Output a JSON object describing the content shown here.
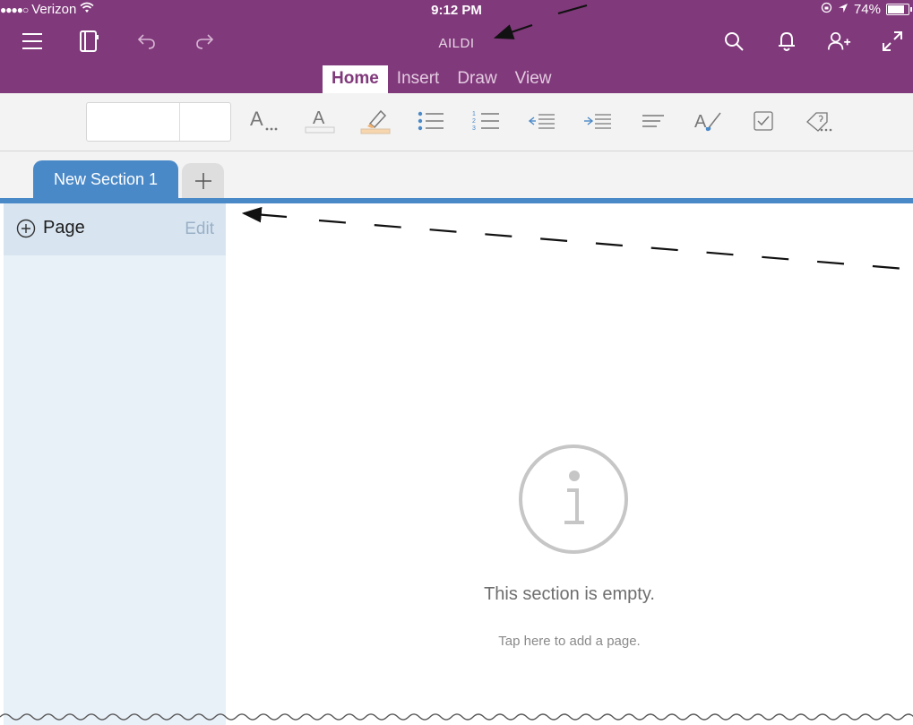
{
  "status_bar": {
    "carrier": "Verizon",
    "time": "9:12 PM",
    "battery": "74%",
    "battery_level": 0.74
  },
  "header": {
    "notebook_title": "AILDI",
    "tabs": [
      {
        "label": "Home",
        "active": true
      },
      {
        "label": "Insert",
        "active": false
      },
      {
        "label": "Draw",
        "active": false
      },
      {
        "label": "View",
        "active": false
      }
    ],
    "left_icons": [
      "hamburger-menu-icon",
      "notebook-icon",
      "undo-icon",
      "redo-icon"
    ],
    "right_icons": [
      "search-icon",
      "bell-icon",
      "add-person-icon",
      "expand-icon"
    ]
  },
  "ribbon": {
    "font_glyph": "A",
    "tools": [
      "font-format",
      "font-color",
      "highlighter",
      "bullet-list",
      "numbered-list",
      "outdent",
      "indent",
      "align",
      "text-style",
      "checkbox-tag",
      "tag-more"
    ]
  },
  "sections": {
    "active_section": "New Section 1",
    "add_section_symbol": "+"
  },
  "pages_panel": {
    "add_page_label": "Page",
    "edit_label": "Edit"
  },
  "empty_state": {
    "title": "This section is empty.",
    "hint": "Tap here to add a page."
  },
  "colors": {
    "header_purple": "#80397b",
    "section_blue": "#4a89c8",
    "pages_panel": "#e8f0f8"
  }
}
